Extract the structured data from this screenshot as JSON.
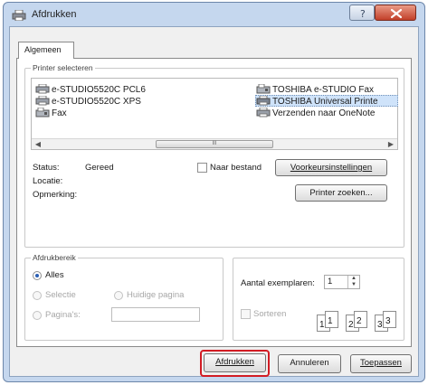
{
  "window": {
    "title": "Afdrukken"
  },
  "tabs": [
    {
      "label": "Algemeen"
    }
  ],
  "printer_group": {
    "label": "Printer selecteren",
    "printers": [
      {
        "name": "e-STUDIO5520C PCL6",
        "selected": false
      },
      {
        "name": "e-STUDIO5520C XPS",
        "selected": false
      },
      {
        "name": "Fax",
        "selected": false
      },
      {
        "name": "TOSHIBA e-STUDIO Fax",
        "selected": false
      },
      {
        "name": "TOSHIBA Universal Printe",
        "selected": true
      },
      {
        "name": "Verzenden naar OneNote",
        "selected": false
      }
    ],
    "scroll_thumb_grip": "III",
    "status_label": "Status:",
    "status_value": "Gereed",
    "location_label": "Locatie:",
    "comment_label": "Opmerking:",
    "print_to_file_label": "Naar bestand",
    "preferences_button": "Voorkeursinstellingen",
    "find_printer_button": "Printer zoeken..."
  },
  "range_group": {
    "label": "Afdrukbereik",
    "all_label": "Alles",
    "selection_label": "Selectie",
    "current_page_label": "Huidige pagina",
    "pages_label": "Pagina's:",
    "pages_value": ""
  },
  "copies_group": {
    "copies_label": "Aantal exemplaren:",
    "copies_value": "1",
    "collate_label": "Sorteren",
    "collate_pages": [
      "1",
      "1",
      "2",
      "2",
      "3",
      "3"
    ]
  },
  "footer": {
    "print_button": "Afdrukken",
    "cancel_button": "Annuleren",
    "apply_button": "Toepassen"
  },
  "colors": {
    "window_frame": "#c5d7ee",
    "close_button": "#c2402a",
    "selection": "#cfe3fa",
    "highlight_ring": "#d21c24"
  }
}
